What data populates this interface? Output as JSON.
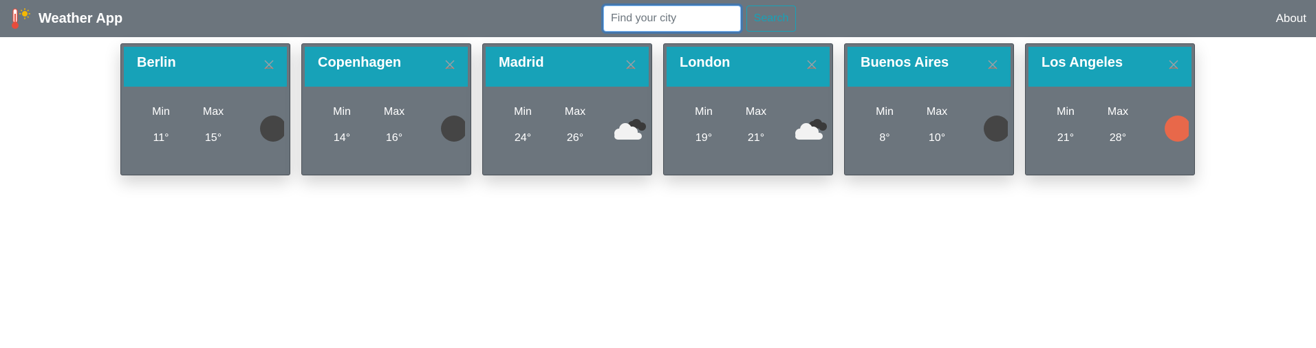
{
  "app": {
    "title": "Weather App",
    "logo_icon": "thermometer-sun-icon"
  },
  "search": {
    "placeholder": "Find your city",
    "value": "",
    "button_label": "Search"
  },
  "nav": {
    "about_label": "About"
  },
  "labels": {
    "min": "Min",
    "max": "Max"
  },
  "colors": {
    "navbar": "#6c757d",
    "card_header": "#17a2b8",
    "sun": "#e8684a",
    "moon": "#454545"
  },
  "cities": [
    {
      "name": "Berlin",
      "min": "11°",
      "max": "15°",
      "icon": "moon-icon"
    },
    {
      "name": "Copenhagen",
      "min": "14°",
      "max": "16°",
      "icon": "moon-icon"
    },
    {
      "name": "Madrid",
      "min": "24°",
      "max": "26°",
      "icon": "cloud-icon"
    },
    {
      "name": "London",
      "min": "19°",
      "max": "21°",
      "icon": "cloud-icon"
    },
    {
      "name": "Buenos Aires",
      "min": "8°",
      "max": "10°",
      "icon": "moon-icon"
    },
    {
      "name": "Los Angeles",
      "min": "21°",
      "max": "28°",
      "icon": "sun-icon"
    }
  ]
}
